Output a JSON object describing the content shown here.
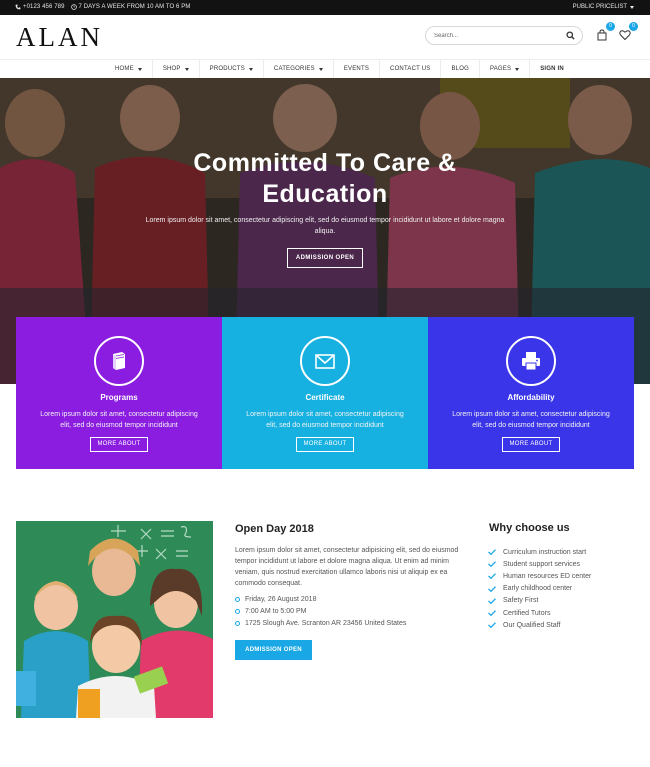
{
  "topbar": {
    "phone": "+0123 456 789",
    "hours": "7 DAYS A WEEK FROM 10 AM TO 6 PM",
    "pricelist": "PUBLIC PRICELIST"
  },
  "header": {
    "logo": "ALAN",
    "search_placeholder": "Search...",
    "cart_count": "0",
    "wishlist_count": "0"
  },
  "nav": {
    "items": [
      {
        "label": "HOME",
        "dropdown": true
      },
      {
        "label": "SHOP",
        "dropdown": true
      },
      {
        "label": "PRODUCTS",
        "dropdown": true
      },
      {
        "label": "CATEGORIES",
        "dropdown": true
      },
      {
        "label": "EVENTS",
        "dropdown": false
      },
      {
        "label": "CONTACT US",
        "dropdown": false
      },
      {
        "label": "BLOG",
        "dropdown": false
      },
      {
        "label": "PAGES",
        "dropdown": true
      },
      {
        "label": "SIGN IN",
        "dropdown": false
      }
    ]
  },
  "hero": {
    "title_line1": "Committed To Care &",
    "title_line2": "Education",
    "text": "Lorem ipsum dolor sit amet, consectetur adipiscing elit, sed do eiusmod tempor incididunt ut labore et dolore magna aliqua.",
    "button": "ADMISSION OPEN"
  },
  "features": [
    {
      "title": "Programs",
      "icon": "book-icon",
      "color": "#8a1de0",
      "text": "Lorem ipsum dolor sit amet, consectetur adipiscing elit, sed do eiusmod tempor incididunt",
      "button": "MORE ABOUT"
    },
    {
      "title": "Certificate",
      "icon": "mail-icon",
      "color": "#16b1e0",
      "text": "Lorem ipsum dolor sit amet, consectetur adipiscing elit, sed do eiusmod tempor incididunt",
      "button": "MORE ABOUT"
    },
    {
      "title": "Affordability",
      "icon": "printer-icon",
      "color": "#3a35e8",
      "text": "Lorem ipsum dolor sit amet, consectetur adipiscing elit, sed do eiusmod tempor incididunt",
      "button": "MORE ABOUT"
    }
  ],
  "open_day": {
    "title": "Open Day 2018",
    "text": "Lorem ipsum dolor sit amet, consectetur adipisicing elit, sed do eiusmod tempor incididunt ut labore et dolore magna aliqua. Ut enim ad minim veniam, quis nostrud exercitation ullamco laboris nisi ut aliquip ex ea commodo consequat.",
    "details": [
      "Friday, 26 August 2018",
      "7:00 AM to 5:00 PM",
      "1725 Slough Ave. Scranton AR 23456 United States"
    ],
    "button": "ADMISSION OPEN"
  },
  "why": {
    "title": "Why choose us",
    "items": [
      "Curriculum instruction start",
      "Student support services",
      "Human resources ED center",
      "Early childhood center",
      "Safety First",
      "Certified Tutors",
      "Our Qualified Staff"
    ]
  },
  "colors": {
    "accent": "#1aa7e5",
    "purple": "#8a1de0",
    "cyan": "#16b1e0",
    "blue": "#3a35e8"
  }
}
